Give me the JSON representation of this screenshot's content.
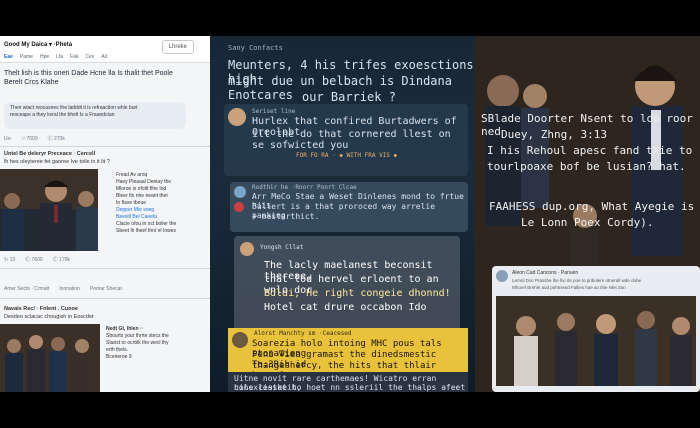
{
  "left": {
    "header": {
      "title": "Good My Daica ▾ ·Pheta",
      "button": "Lhreke"
    },
    "tabs": [
      "Eae",
      "Pame",
      "Hpe",
      "Lfa",
      "Fak",
      "Cev",
      "Ail"
    ],
    "post1": {
      "line1": "Thelt lish is this oneri Dade Hcne lla Is thalit thet Poole",
      "line2": "Berelt Crcs Klahe",
      "bubble_l1": "Then wiact reocasnes the ladddt it is refraaction whle burt",
      "bubble_l2": "reoceape a they kvral the bhelt Is a Fraandctan",
      "actions": [
        "Uo-",
        "□ 7000",
        "Ⓒ 270k"
      ]
    },
    "post2": {
      "title": "Untel Be deleryr Preceace · Cercell",
      "sub": "lh hes oleyteree fet gaoree Ive toile in it lit ?",
      "side": [
        "Fread Av aroq",
        "Haey Pleaaal Deeiay the",
        "Mloroe is ofoltt fihe Iod",
        "Bleer fin nhe eeant thet",
        "In flaxe tbeue",
        "Depper Mie soeg",
        "Beesitl Bel Caeetu",
        "Clacie ofou in oct bolier the",
        "Sbeet lh lheef Ihn/ el Iowes"
      ],
      "counts": [
        "↻ 13",
        "Ⓒ 7600",
        "Ⓒ 170k"
      ],
      "bottom": [
        "Amer Sects · Crmatt",
        "Inonation",
        "Pernar Shecat"
      ]
    },
    "post3": {
      "title": "Navals Recl · Fnlent . Cuooe",
      "sub": "Desdeo sclacac chougish in Eoscdet",
      "side": [
        "Nedt Gt, Ihlen ··",
        "Sbourts your thrrte stecs the",
        "Starist or ocrblk the wecl thy",
        "erth thels.",
        "Bcerieroe 9"
      ]
    }
  },
  "middle": {
    "header": "Sany Confacts",
    "hw1": "Meunters, 4 his trifes exoesctions high",
    "hw2": "might due un belbach is Dindana Enotcares",
    "hw3": "our Barriek ?",
    "card1": {
      "name": "Seriset line",
      "l1": "Hurlex that confired Burtadwers of Oreolobt",
      "l2": "ilt the do that cornered llest on se sofwicted you",
      "l3": "FOR FO RA · ◆ WITH FRA VIS ◆"
    },
    "card2": {
      "name": "Rodthir he ·Rnorr Ponrt Clcae",
      "l1": "Arr MeCo Stae a Weset Dinlenes mond to frtue hiis",
      "l2": "Bullert is a that proroced way arrelie panking",
      "l3": "+ mestarthict."
    },
    "card3": {
      "name": "Yongsh Cllat",
      "l1": "The lacly maelanest beconsit thereae,",
      "l2": "that lod hervel erloent to an wnlo dor",
      "l3": "Bdldi, He right congeie dhonnd!",
      "l4": "Hotel cat drure occabon Ido"
    },
    "card4": {
      "name": "Alorst Manchty sm ·Ceacesed",
      "l1": "Soarezia holo intoing MHC pous tals stonawieng",
      "l2": "Peni Tiea gramast the dinedsmestic To:3Rih id",
      "l3": "thangeshercy, the hits that thlair horas?",
      "l4": "Uitne novit rare carthemaes! Wicatro erran conexciatetit,",
      "l5": "hils lesske ho hoet nn ssleriil the thalps afeet sehlond"
    }
  },
  "right": {
    "hw1": "SBlade Doorter Nsent to ldo roor ned",
    "hw2": "Duey, Zhng, 3:13",
    "hw3": "I his Rehoul apesc fand thie to",
    "hw4": "tourlpoaxe bof be lusian? hat.",
    "hw5": "FAAHESS dup.org, What Ayegie is",
    "hw6": "Le Lonn Poex Cordy).",
    "card": {
      "name": "Aleon Cad Cancons · Panuen",
      "l1": "Lernnl Doc Prasshe lhe fivi rle poe to prdiolere otnerall wde dohe",
      "l2": "Mfroerl Brehle aod pnhtnewd Fallies hae ao thie Nlet dan"
    }
  },
  "colors": {
    "accent": "#1a6fd6",
    "yellow": "#e9c23c",
    "dark": "#172736"
  }
}
